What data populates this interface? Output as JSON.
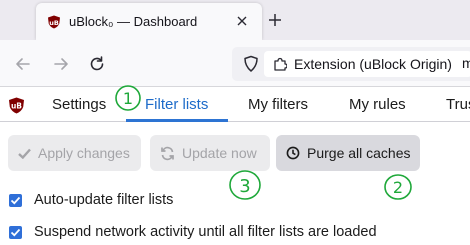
{
  "browser": {
    "tab": {
      "title": "uBlock₀ — Dashboard"
    },
    "urlbar": {
      "identity_label": "Extension (uBlock Origin)",
      "trailing_text": "m"
    }
  },
  "dashboard": {
    "nav": {
      "tabs": [
        {
          "label": "Settings",
          "active": false
        },
        {
          "label": "Filter lists",
          "active": true
        },
        {
          "label": "My filters",
          "active": false
        },
        {
          "label": "My rules",
          "active": false
        },
        {
          "label": "Trus",
          "active": false
        }
      ]
    },
    "toolbar": {
      "apply_label": "Apply changes",
      "update_label": "Update now",
      "purge_label": "Purge all caches"
    },
    "options": [
      {
        "label": "Auto-update filter lists",
        "checked": true
      },
      {
        "label": "Suspend network activity until all filter lists are loaded",
        "checked": true
      }
    ]
  },
  "annotations": {
    "color": "#1fa83a",
    "markers": [
      "1",
      "2",
      "3"
    ]
  },
  "colors": {
    "accent": "#2d74d3",
    "ublock_red": "#800000",
    "annotation_green": "#1fa83a"
  }
}
